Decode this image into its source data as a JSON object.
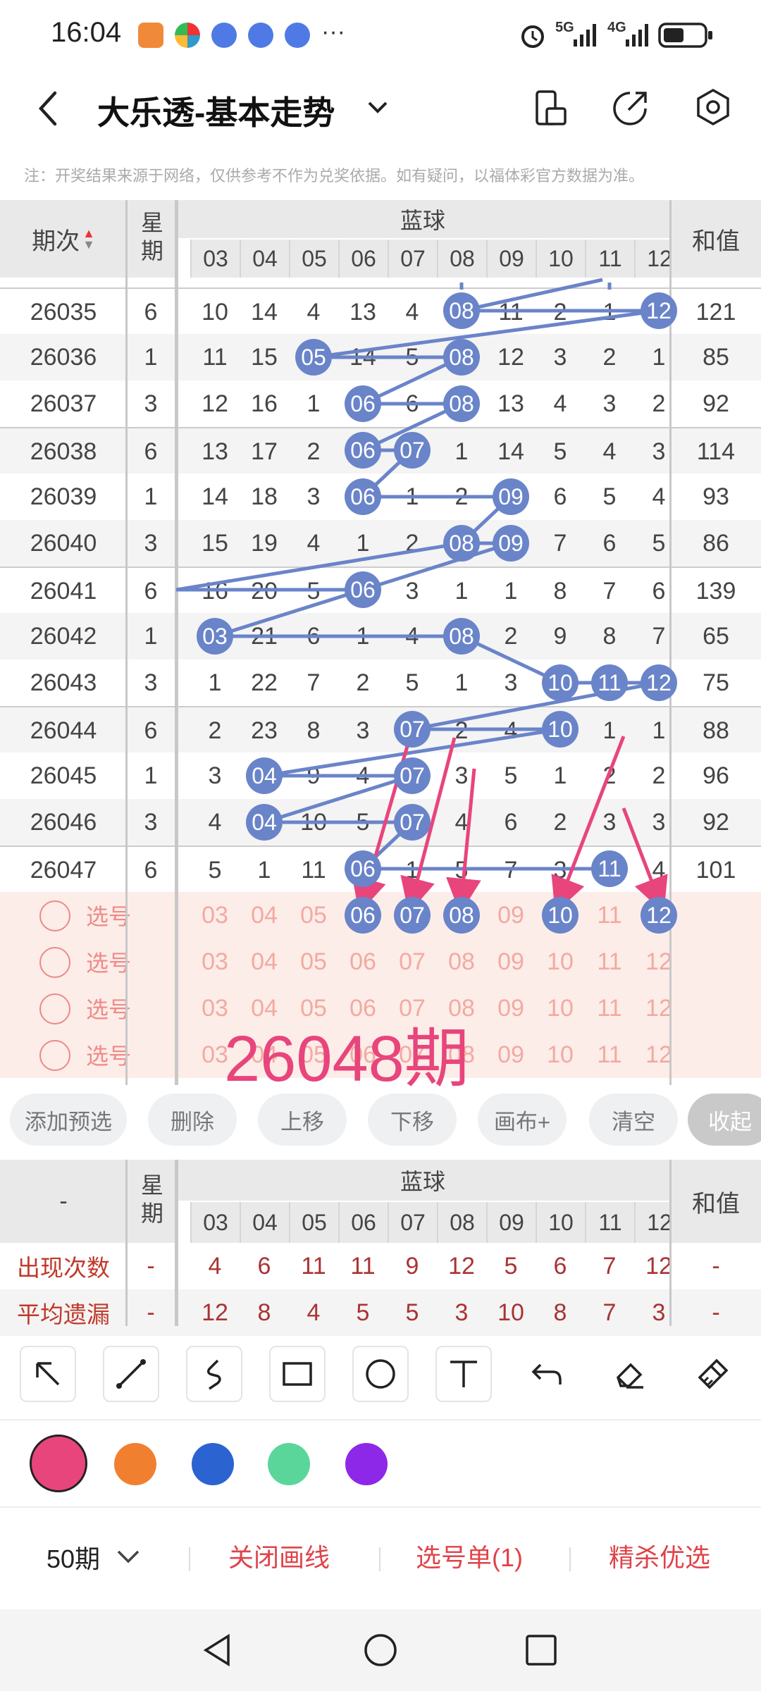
{
  "status_bar": {
    "time": "16:04",
    "dots": "···",
    "net1": "5G",
    "net2": "4G"
  },
  "header": {
    "title": "大乐透-基本走势"
  },
  "notice": "注：开奖结果来源于网络，仅供参考不作为兑奖依据。如有疑问，以福体彩官方数据为准。",
  "table": {
    "col_period": "期次",
    "col_weekday": "星期",
    "group": "蓝球",
    "col_sum": "和值",
    "columns": [
      "03",
      "04",
      "05",
      "06",
      "07",
      "08",
      "09",
      "10",
      "11",
      "12"
    ],
    "rows": [
      {
        "period": "26035",
        "weekday": "6",
        "cells": [
          "10",
          "14",
          "4",
          "13",
          "4",
          "08",
          "11",
          "2",
          "1",
          "12"
        ],
        "sum": "121"
      },
      {
        "period": "26036",
        "weekday": "1",
        "cells": [
          "11",
          "15",
          "05",
          "14",
          "5",
          "08",
          "12",
          "3",
          "2",
          "1"
        ],
        "sum": "85"
      },
      {
        "period": "26037",
        "weekday": "3",
        "cells": [
          "12",
          "16",
          "1",
          "06",
          "6",
          "08",
          "13",
          "4",
          "3",
          "2"
        ],
        "sum": "92"
      },
      {
        "period": "26038",
        "weekday": "6",
        "cells": [
          "13",
          "17",
          "2",
          "06",
          "07",
          "1",
          "14",
          "5",
          "4",
          "3"
        ],
        "sum": "114"
      },
      {
        "period": "26039",
        "weekday": "1",
        "cells": [
          "14",
          "18",
          "3",
          "06",
          "1",
          "2",
          "09",
          "6",
          "5",
          "4"
        ],
        "sum": "93"
      },
      {
        "period": "26040",
        "weekday": "3",
        "cells": [
          "15",
          "19",
          "4",
          "1",
          "2",
          "08",
          "09",
          "7",
          "6",
          "5"
        ],
        "sum": "86"
      },
      {
        "period": "26041",
        "weekday": "6",
        "cells": [
          "16",
          "20",
          "5",
          "06",
          "3",
          "1",
          "1",
          "8",
          "7",
          "6"
        ],
        "sum": "139"
      },
      {
        "period": "26042",
        "weekday": "1",
        "cells": [
          "03",
          "21",
          "6",
          "1",
          "4",
          "08",
          "2",
          "9",
          "8",
          "7"
        ],
        "sum": "65"
      },
      {
        "period": "26043",
        "weekday": "3",
        "cells": [
          "1",
          "22",
          "7",
          "2",
          "5",
          "1",
          "3",
          "10",
          "11",
          "12"
        ],
        "sum": "75"
      },
      {
        "period": "26044",
        "weekday": "6",
        "cells": [
          "2",
          "23",
          "8",
          "3",
          "07",
          "2",
          "4",
          "10",
          "1",
          "1"
        ],
        "sum": "88"
      },
      {
        "period": "26045",
        "weekday": "1",
        "cells": [
          "3",
          "04",
          "9",
          "4",
          "07",
          "3",
          "5",
          "1",
          "2",
          "2"
        ],
        "sum": "96"
      },
      {
        "period": "26046",
        "weekday": "3",
        "cells": [
          "4",
          "04",
          "10",
          "5",
          "07",
          "4",
          "6",
          "2",
          "3",
          "3"
        ],
        "sum": "92"
      },
      {
        "period": "26047",
        "weekday": "6",
        "cells": [
          "5",
          "1",
          "11",
          "06",
          "1",
          "5",
          "7",
          "3",
          "11",
          "4"
        ],
        "sum": "101"
      }
    ],
    "select_label": "选号",
    "selected": [
      "06",
      "07",
      "08",
      "10",
      "12"
    ],
    "overlay_text": "26048期"
  },
  "actions": [
    "添加预选",
    "删除",
    "上移",
    "下移",
    "画布+",
    "清空",
    "收起"
  ],
  "stats": {
    "label_blank": "-",
    "rows": [
      {
        "label": "出现次数",
        "weekday": "-",
        "values": [
          "4",
          "6",
          "11",
          "11",
          "9",
          "12",
          "5",
          "6",
          "7",
          "12"
        ],
        "sum": "-"
      },
      {
        "label": "平均遗漏",
        "weekday": "-",
        "values": [
          "12",
          "8",
          "4",
          "5",
          "5",
          "3",
          "10",
          "8",
          "7",
          "3"
        ],
        "sum": "-"
      }
    ]
  },
  "tools": [
    "pointer-arrow-icon",
    "line-icon",
    "freehand-icon",
    "rectangle-icon",
    "circle-icon",
    "text-icon",
    "undo-icon",
    "eraser-icon",
    "clear-brush-icon"
  ],
  "colors": [
    "#e8457c",
    "#f08030",
    "#2b63d0",
    "#5bd69a",
    "#8d28e8"
  ],
  "bottom": {
    "period": "50期",
    "close": "关闭画线",
    "pick": "选号单(1)",
    "best": "精杀优选"
  }
}
